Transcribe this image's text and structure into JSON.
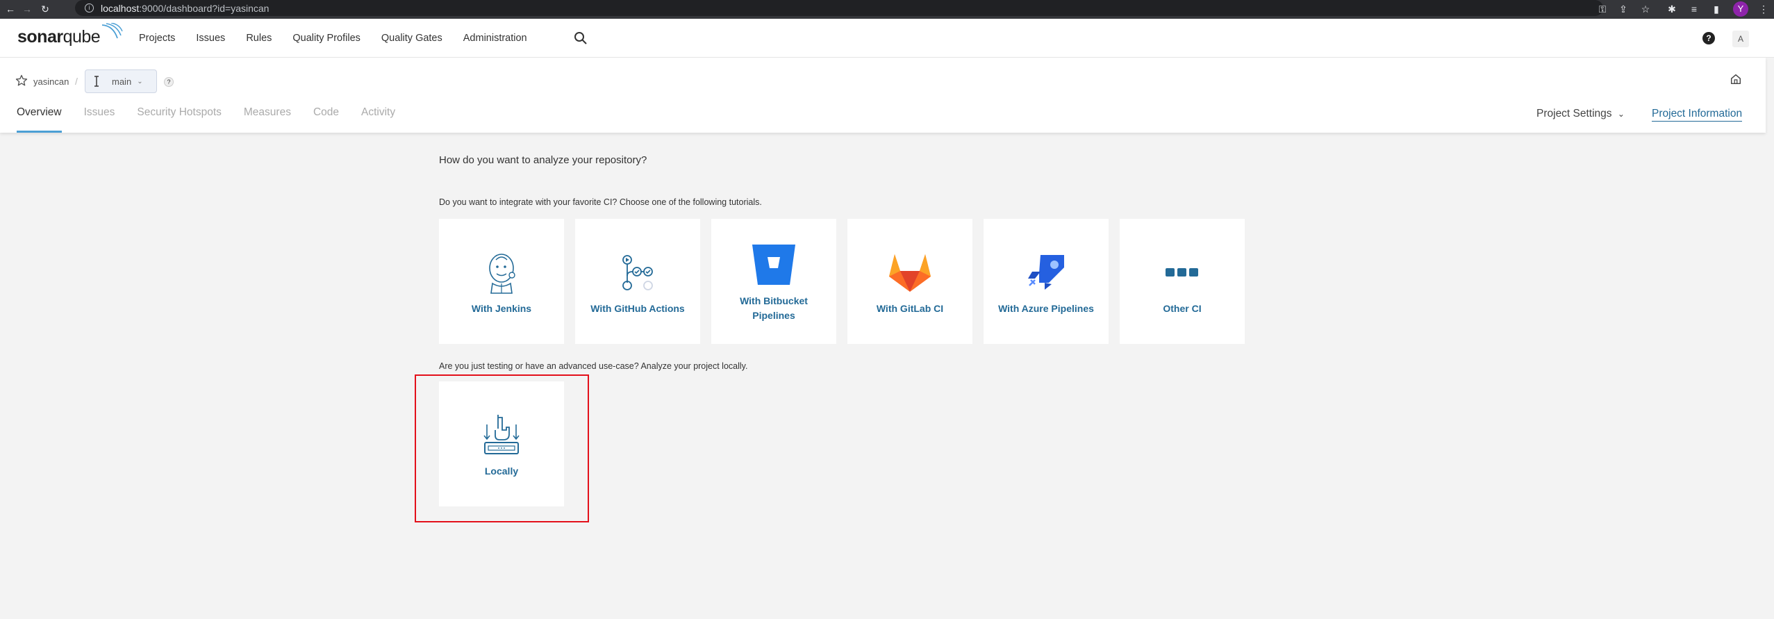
{
  "browser": {
    "url_host": "localhost",
    "url_rest": ":9000/dashboard?id=yasincan",
    "profile_initial": "Y"
  },
  "topnav": {
    "logo_bold": "sonar",
    "logo_regular": "qube",
    "menu": [
      "Projects",
      "Issues",
      "Rules",
      "Quality Profiles",
      "Quality Gates",
      "Administration"
    ],
    "help": "?",
    "user_initial": "A"
  },
  "project": {
    "name": "yasincan",
    "separator": "/",
    "branch": "main",
    "tabs": [
      "Overview",
      "Issues",
      "Security Hotspots",
      "Measures",
      "Code",
      "Activity"
    ],
    "active_tab": "Overview",
    "settings_label": "Project Settings",
    "info_label": "Project Information"
  },
  "main": {
    "question": "How do you want to analyze your repository?",
    "ci_prompt": "Do you want to integrate with your favorite CI? Choose one of the following tutorials.",
    "ci_options": [
      {
        "label": "With Jenkins",
        "icon": "jenkins-icon"
      },
      {
        "label": "With GitHub Actions",
        "icon": "github-actions-icon"
      },
      {
        "label": "With Bitbucket Pipelines",
        "icon": "bitbucket-icon"
      },
      {
        "label": "With GitLab CI",
        "icon": "gitlab-icon"
      },
      {
        "label": "With Azure Pipelines",
        "icon": "azure-pipelines-icon"
      },
      {
        "label": "Other CI",
        "icon": "other-ci-icon"
      }
    ],
    "local_prompt": "Are you just testing or have an advanced use-case? Analyze your project locally.",
    "local_option": {
      "label": "Locally",
      "icon": "locally-icon"
    }
  },
  "colors": {
    "link": "#236a97",
    "active_tab_underline": "#4b9fd5",
    "highlight_border": "#e3101a",
    "background": "#f3f3f3"
  }
}
